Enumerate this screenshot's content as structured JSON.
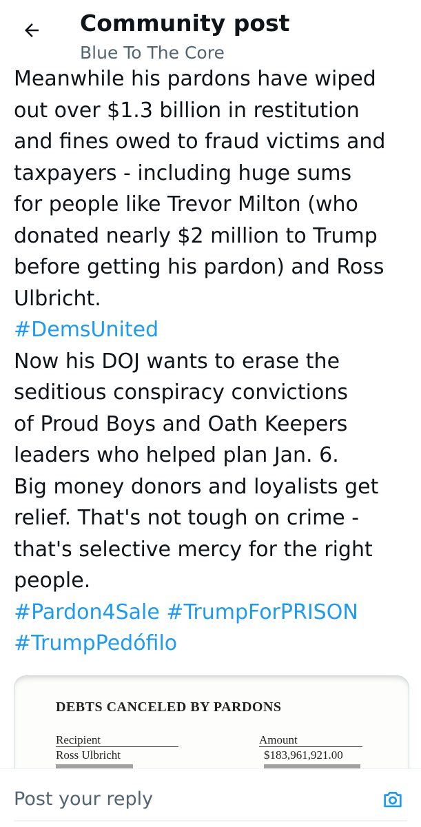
{
  "header": {
    "title": "Community post",
    "subtitle": "Blue To The Core",
    "back_icon": "arrow-left-icon"
  },
  "post": {
    "lines": [
      "Meanwhile his pardons have wiped",
      "out over $1.3 billion in restitution",
      "and fines owed to fraud victims and",
      "taxpayers - including huge sums",
      "for people like Trevor Milton (who",
      "donated nearly $2 million to Trump",
      "before getting his pardon) and Ross",
      "Ulbricht.",
      "#DemsUnited",
      "Now his DOJ wants to erase the",
      "seditious conspiracy convictions",
      "of Proud Boys and Oath Keepers",
      "leaders who helped plan Jan. 6.",
      "Big money donors and loyalists get",
      "relief. That's not tough on crime -",
      "that's selective mercy for the right",
      "people."
    ],
    "hashtags": {
      "pardon4sale": "#Pardon4Sale",
      "trumpforprison": "#TrumpForPRISON",
      "trumppedofilo": "#TrumpPedófilo"
    },
    "hashtag_color": "#1d9bf0"
  },
  "image": {
    "title": "DEBTS CANCELED BY PARDONS",
    "headers": {
      "recipient": "Recipient",
      "amount": "Amount"
    },
    "rows": [
      {
        "recipient": "Ross Ulbricht",
        "amount": "$183,961,921.00"
      }
    ]
  },
  "reply": {
    "placeholder": "Post your reply",
    "camera_icon": "camera-icon",
    "accent": "#1d9bf0"
  }
}
